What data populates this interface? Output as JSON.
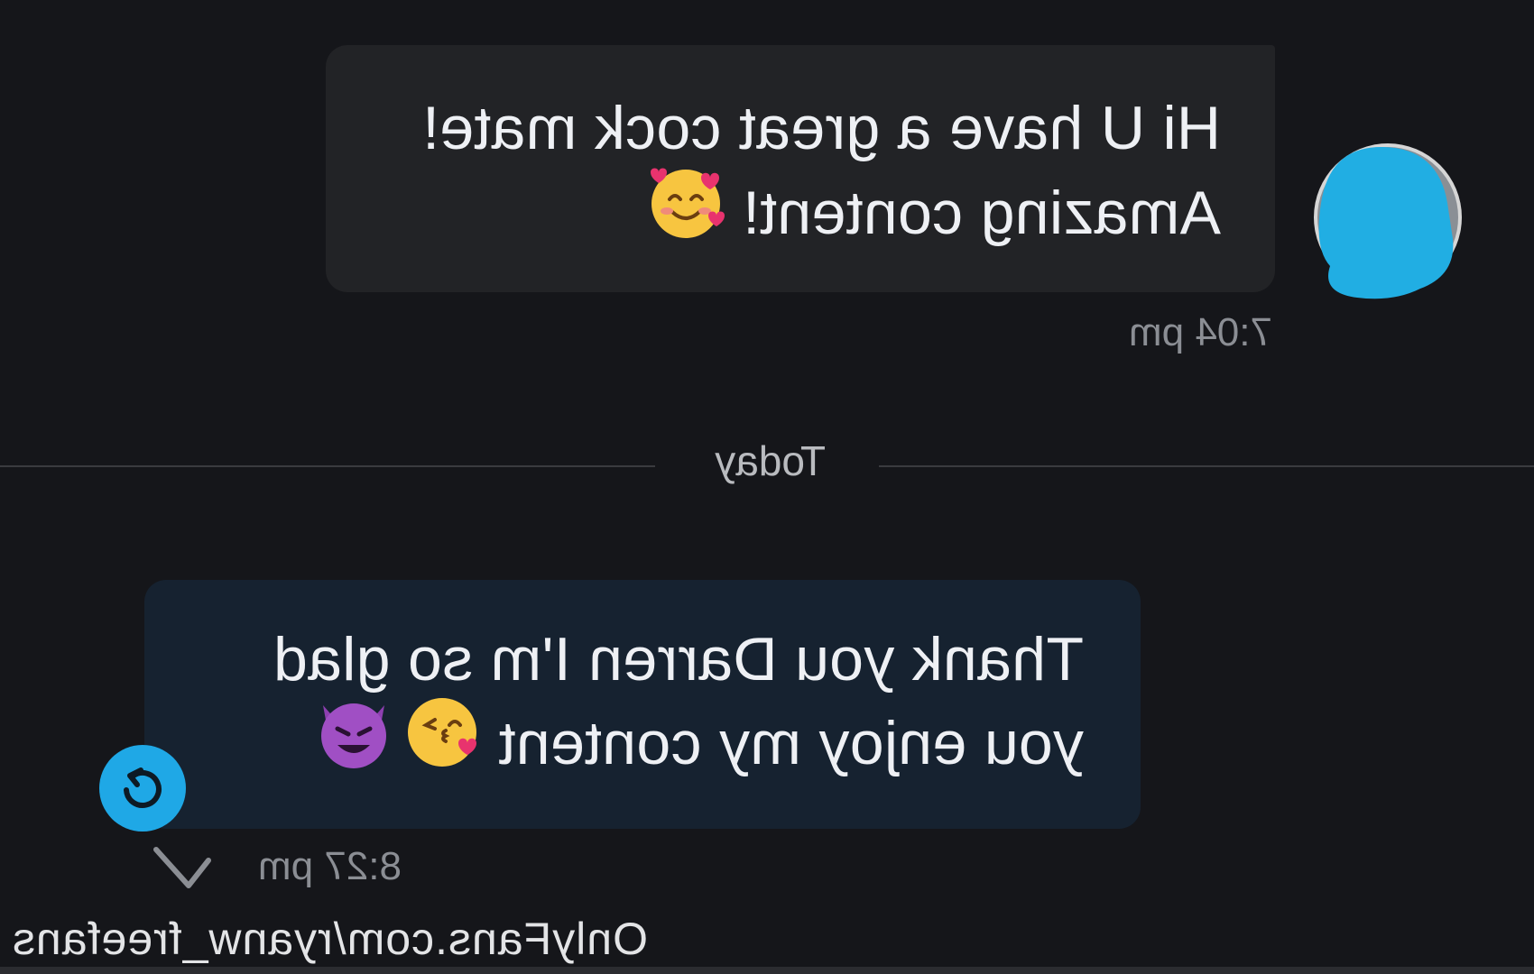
{
  "conversation": {
    "incoming": {
      "line1": "Hi U have a great cock mate!",
      "line2": "Amazing content!",
      "emoji": "smiling-face-with-hearts",
      "time": "7:04 pm"
    },
    "divider_label": "Today",
    "outgoing": {
      "line1": "Thank you Darren I'm so glad",
      "line2": "you enjoy my content",
      "emojis": [
        "face-blowing-a-kiss",
        "smiling-face-with-horns"
      ],
      "time": "8:27 pm"
    }
  },
  "watermark": "OnlyFans.com/ryanw_freefans",
  "colors": {
    "background": "#15161a",
    "incoming_bubble": "#222326",
    "outgoing_bubble": "#162230",
    "accent": "#1fa8e6",
    "timestamp": "#8b8e94"
  }
}
